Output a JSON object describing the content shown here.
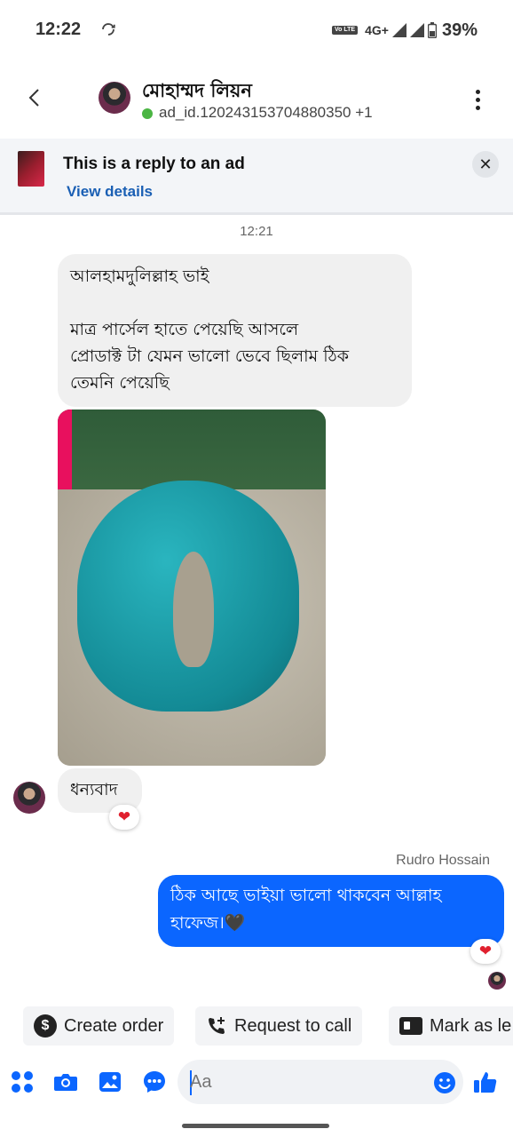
{
  "status_bar": {
    "time": "12:22",
    "volte_label": "Vo\nLTE",
    "network": "4G+",
    "battery": "39%"
  },
  "header": {
    "name": "মোহাম্মদ লিয়ন",
    "subtitle": "ad_id.120243153704880350 +1",
    "online": true
  },
  "ad_banner": {
    "title": "This is a reply to an ad",
    "link": "View details"
  },
  "chat": {
    "timestamp": "12:21",
    "messages": [
      {
        "direction": "incoming",
        "lines": [
          "আলহামদুলিল্লাহ ভাই",
          "",
          "মাত্র পার্সেল হাতে পেয়েছি আসলে",
          "প্রোডাক্ট টা যেমন ভালো ভেবে ছিলাম ঠিক",
          "তেমনি পেয়েছি"
        ]
      },
      {
        "direction": "incoming",
        "type": "photo"
      },
      {
        "direction": "incoming",
        "text": "ধন্যবাদ",
        "reaction": "❤"
      },
      {
        "direction": "outgoing",
        "sender": "Rudro Hossain",
        "lines": [
          "ঠিক আছে ভাইয়া ভালো থাকবেন আল্লাহ",
          "হাফেজ।🖤"
        ],
        "reaction": "❤"
      }
    ]
  },
  "quick_actions": [
    {
      "label": "Create order",
      "icon": "dollar-icon"
    },
    {
      "label": "Request to call",
      "icon": "phone-add-icon"
    },
    {
      "label": "Mark as le",
      "icon": "id-card-icon"
    }
  ],
  "composer": {
    "placeholder": "Aa"
  },
  "colors": {
    "accent": "#0b66ff",
    "online": "#4bb543",
    "heart": "#e0202e",
    "bubble_incoming": "#f0f0f0"
  }
}
